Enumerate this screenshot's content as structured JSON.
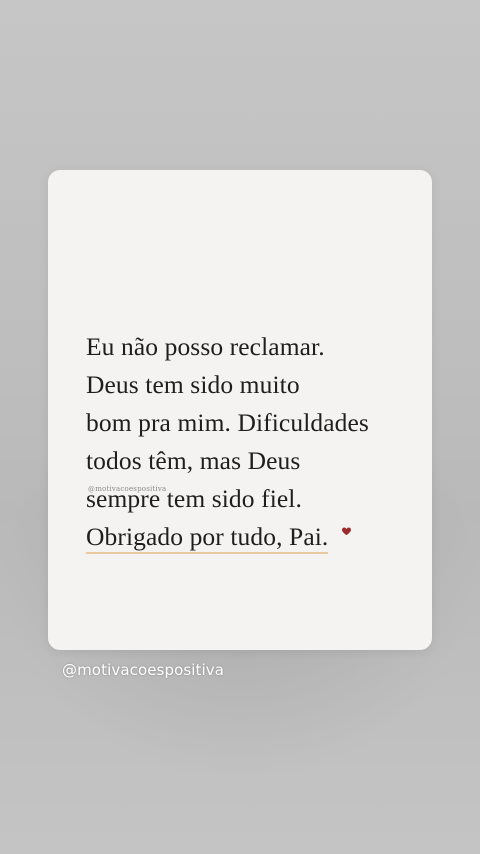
{
  "quote": {
    "lines": [
      "Eu não posso reclamar.",
      "Deus tem sido muito",
      "bom pra mim. Dificuldades",
      "todos têm, mas Deus",
      "sempre tem sido fiel.",
      "Obrigado por tudo, Pai."
    ],
    "heart_icon": "heart-icon",
    "accent_color": "#9b2a2a",
    "underline_color": "#e9c9a0"
  },
  "watermark": "@motivacoespositiva",
  "handle": "@motivacoespositiva",
  "colors": {
    "background": "#c2c2c2",
    "card": "#f4f3f2",
    "text": "#1e1e1e"
  }
}
